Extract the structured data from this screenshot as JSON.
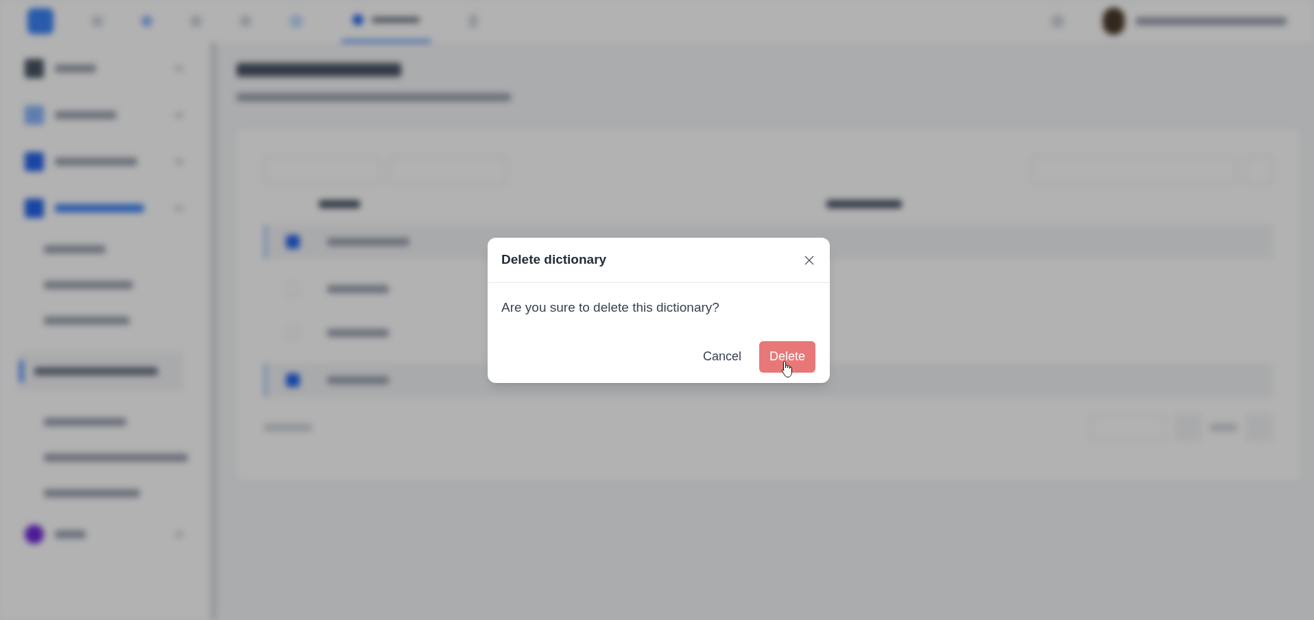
{
  "dialog": {
    "title": "Delete dictionary",
    "message": "Are you sure to delete this dictionary?",
    "buttons": [
      {
        "label": "Cancel",
        "kind": "secondary"
      },
      {
        "label": "Delete",
        "kind": "danger"
      }
    ]
  }
}
